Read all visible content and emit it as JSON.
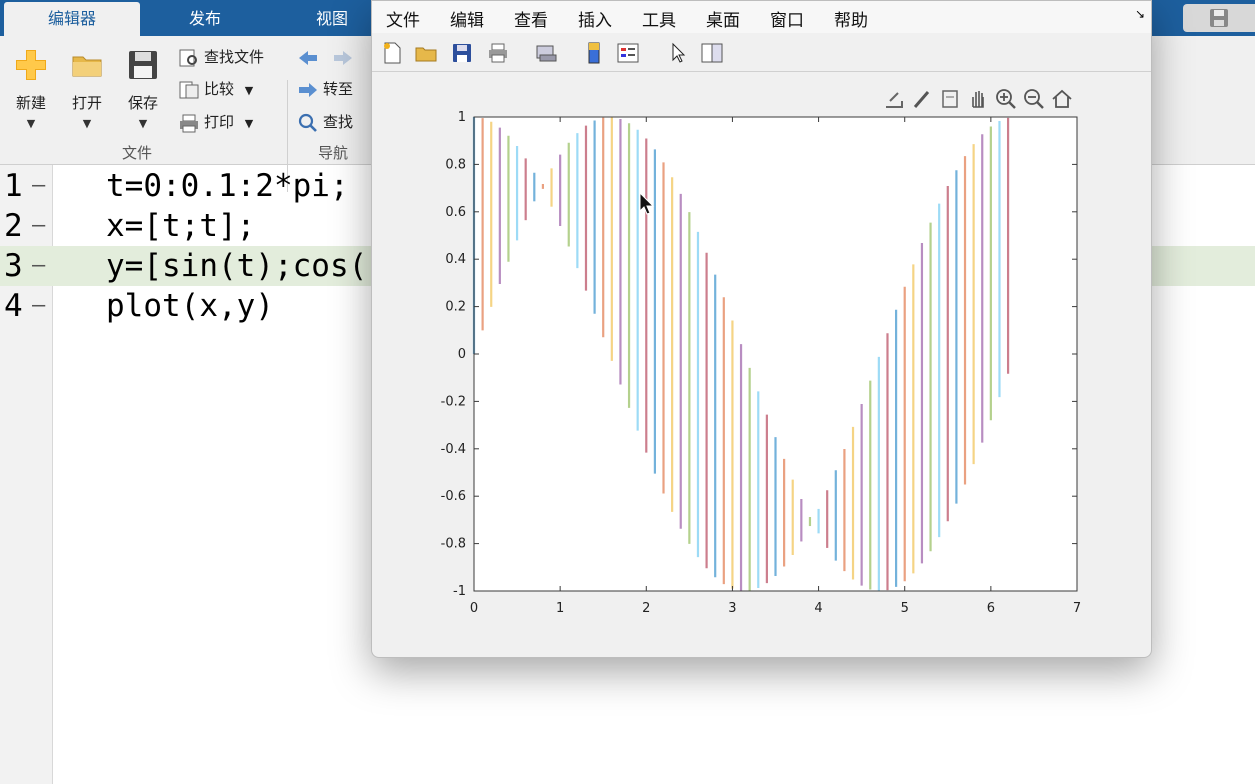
{
  "editor": {
    "tabs": [
      "编辑器",
      "发布",
      "视图"
    ],
    "ribbon": {
      "new_label": "新建",
      "open_label": "打开",
      "save_label": "保存",
      "find_files_label": "查找文件",
      "compare_label": "比较",
      "print_label": "打印",
      "goto_label": "转至",
      "find_label": "查找",
      "group_file": "文件",
      "group_nav": "导航"
    },
    "code_lines": [
      {
        "num": "1",
        "text": "t=0:0.1:2*pi;"
      },
      {
        "num": "2",
        "text": "x=[t;t];"
      },
      {
        "num": "3",
        "text": "y=[sin(t);cos("
      },
      {
        "num": "4",
        "text": "plot(x,y)"
      }
    ],
    "highlighted_line": 3
  },
  "figure": {
    "menu": [
      "文件",
      "编辑",
      "查看",
      "插入",
      "工具",
      "桌面",
      "窗口",
      "帮助"
    ],
    "toolbar_icons": [
      "new-figure-icon",
      "open-file-icon",
      "save-icon",
      "print-icon",
      "link-plot-icon",
      "colorbar-icon",
      "legend-icon",
      "pointer-icon",
      "property-inspector-icon"
    ],
    "axes_toolbar_icons": [
      "export-icon",
      "brush-icon",
      "data-tips-icon",
      "pan-hand-icon",
      "zoom-in-icon",
      "zoom-out-icon",
      "home-icon"
    ]
  },
  "chart_data": {
    "type": "line",
    "title": "",
    "xlabel": "",
    "ylabel": "",
    "xlim": [
      0,
      7
    ],
    "ylim": [
      -1,
      1
    ],
    "xticks": [
      "0",
      "1",
      "2",
      "3",
      "4",
      "5",
      "6",
      "7"
    ],
    "yticks": [
      "1",
      "0.8",
      "0.6",
      "0.4",
      "0.2",
      "0",
      "-0.2",
      "-0.4",
      "-0.6",
      "-0.8",
      "-1"
    ],
    "grid": false,
    "description_of_series": "",
    "t_values": [
      0,
      0.1,
      0.2,
      0.3,
      0.4,
      0.5,
      0.6,
      0.7,
      0.8,
      0.9,
      1,
      1.1,
      1.2,
      1.3,
      1.4,
      1.5,
      1.6,
      1.7,
      1.8,
      1.9,
      2,
      2.1,
      2.2,
      2.3,
      2.4,
      2.5,
      2.6,
      2.7,
      2.8,
      2.9,
      3,
      3.1,
      3.2,
      3.3,
      3.4,
      3.5,
      3.6,
      3.7,
      3.8,
      3.9,
      4,
      4.1,
      4.2,
      4.3,
      4.4,
      4.5,
      4.6,
      4.7,
      4.8,
      4.9,
      5,
      5.1,
      5.2,
      5.3,
      5.4,
      5.5,
      5.6,
      5.7,
      5.8,
      5.9,
      6,
      6.1,
      6.2
    ],
    "segment_endpoints": [
      "sin(t)",
      "cos(t)"
    ],
    "series_colors": [
      "#0072bd",
      "#d95319",
      "#edb120",
      "#7e2f8e",
      "#77ac30",
      "#4dbeee",
      "#a2142f"
    ],
    "line_opacity": 0.55
  }
}
